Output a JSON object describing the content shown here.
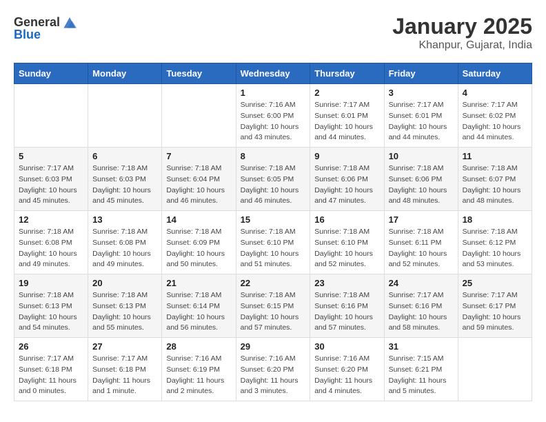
{
  "header": {
    "logo": {
      "general": "General",
      "blue": "Blue"
    },
    "title": "January 2025",
    "location": "Khanpur, Gujarat, India"
  },
  "calendar": {
    "days_of_week": [
      "Sunday",
      "Monday",
      "Tuesday",
      "Wednesday",
      "Thursday",
      "Friday",
      "Saturday"
    ],
    "weeks": [
      [
        {
          "day": "",
          "info": ""
        },
        {
          "day": "",
          "info": ""
        },
        {
          "day": "",
          "info": ""
        },
        {
          "day": "1",
          "info": "Sunrise: 7:16 AM\nSunset: 6:00 PM\nDaylight: 10 hours\nand 43 minutes."
        },
        {
          "day": "2",
          "info": "Sunrise: 7:17 AM\nSunset: 6:01 PM\nDaylight: 10 hours\nand 44 minutes."
        },
        {
          "day": "3",
          "info": "Sunrise: 7:17 AM\nSunset: 6:01 PM\nDaylight: 10 hours\nand 44 minutes."
        },
        {
          "day": "4",
          "info": "Sunrise: 7:17 AM\nSunset: 6:02 PM\nDaylight: 10 hours\nand 44 minutes."
        }
      ],
      [
        {
          "day": "5",
          "info": "Sunrise: 7:17 AM\nSunset: 6:03 PM\nDaylight: 10 hours\nand 45 minutes."
        },
        {
          "day": "6",
          "info": "Sunrise: 7:18 AM\nSunset: 6:03 PM\nDaylight: 10 hours\nand 45 minutes."
        },
        {
          "day": "7",
          "info": "Sunrise: 7:18 AM\nSunset: 6:04 PM\nDaylight: 10 hours\nand 46 minutes."
        },
        {
          "day": "8",
          "info": "Sunrise: 7:18 AM\nSunset: 6:05 PM\nDaylight: 10 hours\nand 46 minutes."
        },
        {
          "day": "9",
          "info": "Sunrise: 7:18 AM\nSunset: 6:06 PM\nDaylight: 10 hours\nand 47 minutes."
        },
        {
          "day": "10",
          "info": "Sunrise: 7:18 AM\nSunset: 6:06 PM\nDaylight: 10 hours\nand 48 minutes."
        },
        {
          "day": "11",
          "info": "Sunrise: 7:18 AM\nSunset: 6:07 PM\nDaylight: 10 hours\nand 48 minutes."
        }
      ],
      [
        {
          "day": "12",
          "info": "Sunrise: 7:18 AM\nSunset: 6:08 PM\nDaylight: 10 hours\nand 49 minutes."
        },
        {
          "day": "13",
          "info": "Sunrise: 7:18 AM\nSunset: 6:08 PM\nDaylight: 10 hours\nand 49 minutes."
        },
        {
          "day": "14",
          "info": "Sunrise: 7:18 AM\nSunset: 6:09 PM\nDaylight: 10 hours\nand 50 minutes."
        },
        {
          "day": "15",
          "info": "Sunrise: 7:18 AM\nSunset: 6:10 PM\nDaylight: 10 hours\nand 51 minutes."
        },
        {
          "day": "16",
          "info": "Sunrise: 7:18 AM\nSunset: 6:10 PM\nDaylight: 10 hours\nand 52 minutes."
        },
        {
          "day": "17",
          "info": "Sunrise: 7:18 AM\nSunset: 6:11 PM\nDaylight: 10 hours\nand 52 minutes."
        },
        {
          "day": "18",
          "info": "Sunrise: 7:18 AM\nSunset: 6:12 PM\nDaylight: 10 hours\nand 53 minutes."
        }
      ],
      [
        {
          "day": "19",
          "info": "Sunrise: 7:18 AM\nSunset: 6:13 PM\nDaylight: 10 hours\nand 54 minutes."
        },
        {
          "day": "20",
          "info": "Sunrise: 7:18 AM\nSunset: 6:13 PM\nDaylight: 10 hours\nand 55 minutes."
        },
        {
          "day": "21",
          "info": "Sunrise: 7:18 AM\nSunset: 6:14 PM\nDaylight: 10 hours\nand 56 minutes."
        },
        {
          "day": "22",
          "info": "Sunrise: 7:18 AM\nSunset: 6:15 PM\nDaylight: 10 hours\nand 57 minutes."
        },
        {
          "day": "23",
          "info": "Sunrise: 7:18 AM\nSunset: 6:16 PM\nDaylight: 10 hours\nand 57 minutes."
        },
        {
          "day": "24",
          "info": "Sunrise: 7:17 AM\nSunset: 6:16 PM\nDaylight: 10 hours\nand 58 minutes."
        },
        {
          "day": "25",
          "info": "Sunrise: 7:17 AM\nSunset: 6:17 PM\nDaylight: 10 hours\nand 59 minutes."
        }
      ],
      [
        {
          "day": "26",
          "info": "Sunrise: 7:17 AM\nSunset: 6:18 PM\nDaylight: 11 hours\nand 0 minutes."
        },
        {
          "day": "27",
          "info": "Sunrise: 7:17 AM\nSunset: 6:18 PM\nDaylight: 11 hours\nand 1 minute."
        },
        {
          "day": "28",
          "info": "Sunrise: 7:16 AM\nSunset: 6:19 PM\nDaylight: 11 hours\nand 2 minutes."
        },
        {
          "day": "29",
          "info": "Sunrise: 7:16 AM\nSunset: 6:20 PM\nDaylight: 11 hours\nand 3 minutes."
        },
        {
          "day": "30",
          "info": "Sunrise: 7:16 AM\nSunset: 6:20 PM\nDaylight: 11 hours\nand 4 minutes."
        },
        {
          "day": "31",
          "info": "Sunrise: 7:15 AM\nSunset: 6:21 PM\nDaylight: 11 hours\nand 5 minutes."
        },
        {
          "day": "",
          "info": ""
        }
      ]
    ]
  }
}
